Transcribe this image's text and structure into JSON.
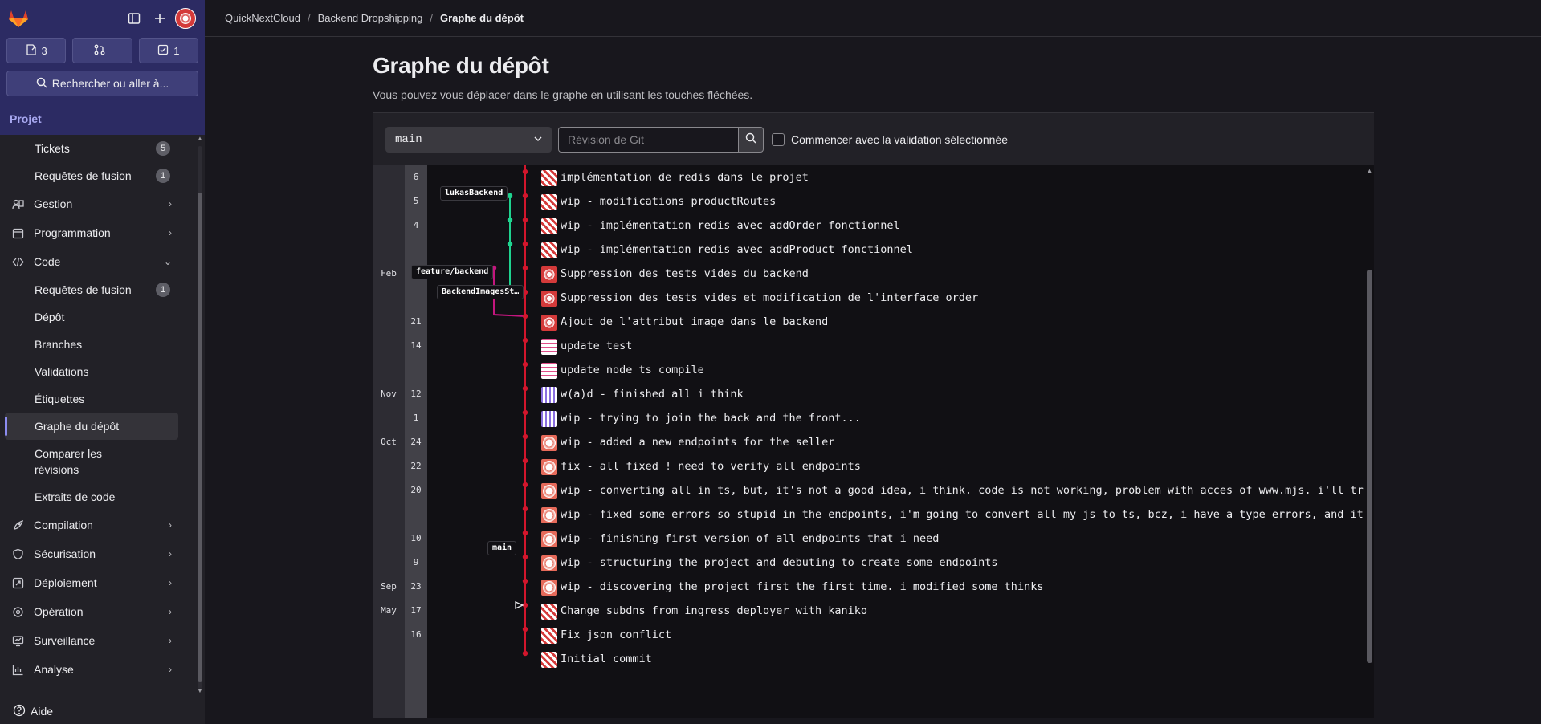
{
  "sidebar": {
    "counts": {
      "issues": "3",
      "mrs": "",
      "todos": "1"
    },
    "search_label": "Rechercher ou aller à...",
    "project_label": "Projet",
    "items": {
      "tickets": {
        "label": "Tickets",
        "badge": "5"
      },
      "merge_requests": {
        "label": "Requêtes de fusion",
        "badge": "1"
      },
      "gestion": "Gestion",
      "programmation": "Programmation",
      "code": "Code",
      "code_mr": {
        "label": "Requêtes de fusion",
        "badge": "1"
      },
      "depot": "Dépôt",
      "branches": "Branches",
      "validations": "Validations",
      "etiquettes": "Étiquettes",
      "graphe": "Graphe du dépôt",
      "comparer": "Comparer les révisions",
      "extraits": "Extraits de code",
      "compilation": "Compilation",
      "securisation": "Sécurisation",
      "deploiement": "Déploiement",
      "operation": "Opération",
      "surveillance": "Surveillance",
      "analyse": "Analyse"
    },
    "help": "Aide"
  },
  "breadcrumb": [
    "QuickNextCloud",
    "Backend Dropshipping",
    "Graphe du dépôt"
  ],
  "page": {
    "title": "Graphe du dépôt",
    "description": "Vous pouvez vous déplacer dans le graphe en utilisant les touches fléchées."
  },
  "toolbar": {
    "branch": "main",
    "revision_placeholder": "Révision de Git",
    "checkbox_label": "Commencer avec la validation sélectionnée"
  },
  "refs": {
    "lukas": "lukasBackend",
    "feature": "feature/backend",
    "images": "BackendImagesSt…",
    "main": "main"
  },
  "commits": [
    {
      "month": "",
      "day": "6",
      "message": "implémentation de redis dans le projet"
    },
    {
      "month": "",
      "day": "5",
      "message": "wip - modifications productRoutes"
    },
    {
      "month": "",
      "day": "4",
      "message": "wip - implémentation redis avec addOrder fonctionnel"
    },
    {
      "month": "",
      "day": "",
      "message": "wip - implémentation redis avec addProduct fonctionnel"
    },
    {
      "month": "Feb",
      "day": "",
      "message": "Suppression des tests vides du backend"
    },
    {
      "month": "",
      "day": "",
      "message": "Suppression des tests vides et modification de l'interface order"
    },
    {
      "month": "",
      "day": "21",
      "message": "Ajout de l'attribut image dans le backend"
    },
    {
      "month": "",
      "day": "14",
      "message": "update test"
    },
    {
      "month": "",
      "day": "",
      "message": "update node ts compile"
    },
    {
      "month": "Nov",
      "day": "12",
      "message": "w(a)d - finished all i think"
    },
    {
      "month": "",
      "day": "1",
      "message": "wip - trying to join the back and the front..."
    },
    {
      "month": "Oct",
      "day": "24",
      "message": "wip - added a new endpoints for the seller"
    },
    {
      "month": "",
      "day": "22",
      "message": "fix - all fixed ! need to verify all endpoints"
    },
    {
      "month": "",
      "day": "20",
      "message": "wip - converting all in ts, but, it's not a good idea, i think. code is not working, problem with acces of www.mjs. i'll try after"
    },
    {
      "month": "",
      "day": "",
      "message": "wip - fixed some errors so stupid in the endpoints, i'm going to convert all my js to ts, bcz, i have a type errors, and it's stupid"
    },
    {
      "month": "",
      "day": "10",
      "message": "wip - finishing first version of all endpoints that i need"
    },
    {
      "month": "",
      "day": "9",
      "message": "wip - structuring the project and debuting to create some endpoints"
    },
    {
      "month": "Sep",
      "day": "23",
      "message": "wip - discovering the project first the first time. i modified some thinks"
    },
    {
      "month": "May",
      "day": "17",
      "message": "Change subdns from ingress deployer with kaniko"
    },
    {
      "month": "",
      "day": "16",
      "message": "Fix json conflict"
    },
    {
      "month": "",
      "day": "",
      "message": "Initial commit"
    }
  ],
  "colors": {
    "main_line": "#d2162c",
    "branch_green": "#1fd38f",
    "branch_magenta": "#c3167e",
    "accent": "#8c8cf0"
  }
}
